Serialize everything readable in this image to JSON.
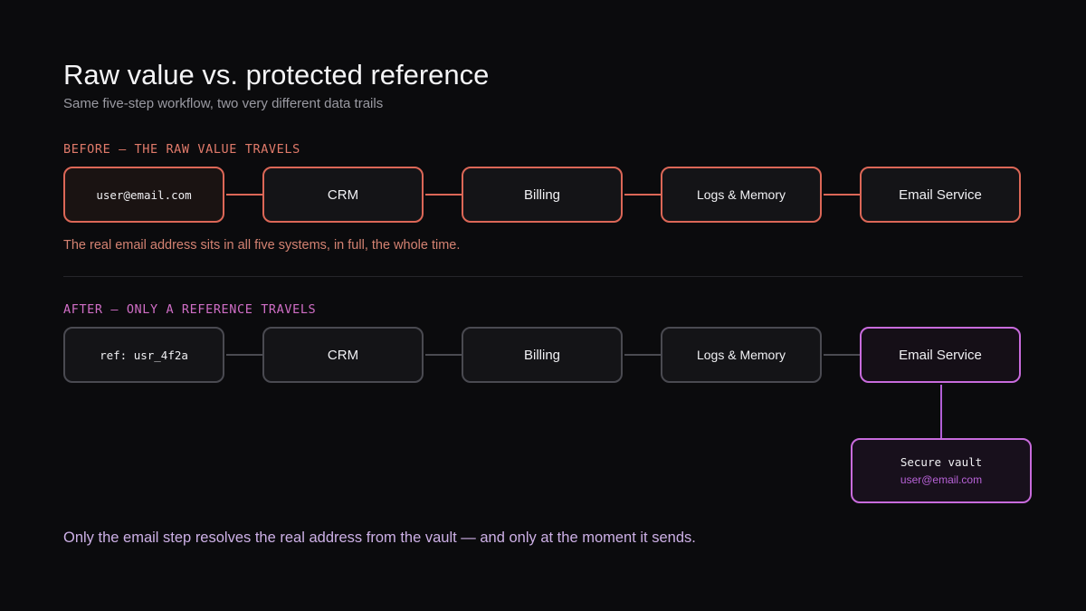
{
  "header": {
    "title": "Raw value vs. protected reference",
    "subtitle": "Same five-step workflow, two very different data trails"
  },
  "before": {
    "label": "BEFORE — THE RAW VALUE TRAVELS",
    "steps": [
      "user@email.com",
      "CRM",
      "Billing",
      "Logs & Memory",
      "Email Service"
    ],
    "note": "The real email address sits in all five systems, in full, the whole time."
  },
  "after": {
    "label": "AFTER — ONLY A REFERENCE TRAVELS",
    "steps": [
      "ref: usr_4f2a",
      "CRM",
      "Billing",
      "Logs & Memory",
      "Email Service"
    ],
    "vault": {
      "title": "Secure vault",
      "value": "user@email.com"
    }
  },
  "conclusion": "Only the email step resolves the real address from the vault — and only at the moment it sends.",
  "colors": {
    "background": "#0b0b0d",
    "before_accent": "#dc6757",
    "after_accent": "#c86bdc",
    "neutral_border": "#4a4a51"
  }
}
